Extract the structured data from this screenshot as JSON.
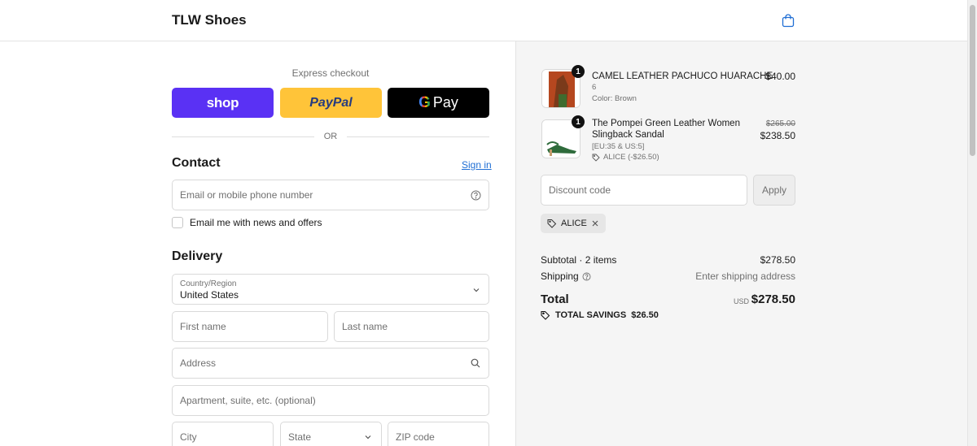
{
  "header": {
    "brand": "TLW Shoes"
  },
  "express": {
    "title": "Express checkout",
    "shop_label": "shop",
    "paypal_label": "PayPal",
    "gpay_label": "Pay",
    "or_label": "OR"
  },
  "contact": {
    "title": "Contact",
    "sign_in": "Sign in",
    "email_placeholder": "Email or mobile phone number",
    "news_label": "Email me with news and offers"
  },
  "delivery": {
    "title": "Delivery",
    "country_label": "Country/Region",
    "country_value": "United States",
    "first_name_placeholder": "First name",
    "last_name_placeholder": "Last name",
    "address_placeholder": "Address",
    "apartment_placeholder": "Apartment, suite, etc. (optional)",
    "city_placeholder": "City",
    "state_placeholder": "State",
    "zip_placeholder": "ZIP code"
  },
  "cart": {
    "items": [
      {
        "qty": "1",
        "name": "CAMEL LEATHER PACHUCO HUARACHE",
        "variant": "6",
        "detail": "Color: Brown",
        "price": "$40.00"
      },
      {
        "qty": "1",
        "name_line1": "The Pompei Green Leather Women",
        "name_line2": "Slingback Sandal",
        "variant": "[EU:35 & US:5]",
        "discount": "ALICE (-$26.50)",
        "original_price": "$265.00",
        "price": "$238.50"
      }
    ],
    "discount_placeholder": "Discount code",
    "apply_label": "Apply",
    "applied_code": "ALICE",
    "subtotal_label": "Subtotal · 2 items",
    "subtotal_value": "$278.50",
    "shipping_label": "Shipping",
    "shipping_value": "Enter shipping address",
    "total_label": "Total",
    "currency": "USD",
    "total_value": "$278.50",
    "savings_label": "TOTAL SAVINGS",
    "savings_value": "$26.50"
  },
  "colors": {
    "shop": "#5a31f4",
    "paypal": "#ffc439",
    "gpay": "#000000",
    "link": "#1f6ed4",
    "summary_bg": "#f5f5f5"
  }
}
